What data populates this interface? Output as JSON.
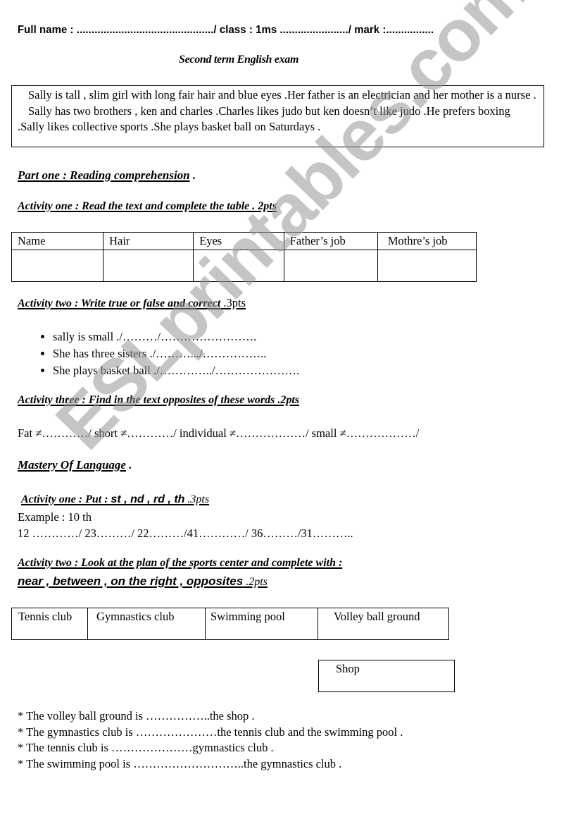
{
  "header": {
    "full_name_label": "Full name :",
    "full_name_blank": "............................................../",
    "class_label": " class : 1ms",
    "class_blank": " ......................./",
    "mark_label": " mark :",
    "mark_blank": "................",
    "title": "Second term English exam"
  },
  "passage": {
    "paragraphs": [
      "Sally is tall , slim girl with long fair hair and blue eyes .Her father is an electrician and her mother is a nurse .",
      "Sally has two brothers , ken and charles .Charles likes judo but ken doesn’t like judo .He prefers boxing .Sally likes collective sports .She plays basket ball on Saturdays ."
    ]
  },
  "part_one": {
    "heading": "Part one : Reading comprehension",
    "heading_suffix": " .",
    "activity_one": {
      "heading": "Activity one : Read the text and complete the table . 2pts",
      "table_headers": [
        "Name",
        "Hair",
        "Eyes",
        "Father’s job",
        "Mothre’s job"
      ],
      "table_blank_row": [
        "",
        "",
        "",
        "",
        ""
      ]
    },
    "activity_two": {
      "heading": "Activity two : Write true or false and correct",
      "points": " .3pts",
      "items": [
        "sally is small ./………/…………………….",
        "She  has three sisters ./……….../……………..",
        "She plays basket ball ./…………../…………………."
      ]
    },
    "activity_three": {
      "heading": "Activity three : Find in the text opposites of these words .2pts",
      "line": "Fat ≠…………/ short ≠…………/ individual ≠………………/ small ≠………………/"
    }
  },
  "mastery": {
    "heading": "Mastery Of Language",
    "heading_suffix": " .",
    "activity_one": {
      "heading_prefix": "Activity one : Put : ",
      "heading_suffixes": "st , nd , rd , th",
      "points": " .3pts",
      "example": "Example : 10 th",
      "line": " 12 …………/ 23………/ 22………/41…………/ 36………/31……….."
    },
    "activity_two": {
      "heading": "Activity two : Look at the plan of the sports center and complete with :",
      "words": "near , between , on the right , opposites",
      "points": " .2pts",
      "places": [
        "Tennis club",
        "Gymnastics club",
        "Swimming pool",
        "Volley ball ground"
      ],
      "shop": "Shop",
      "sentences": [
        "* The volley ball ground is ……………..the shop .",
        "* The gymnastics club is …………………the tennis club and the swimming pool .",
        "* The tennis club is  …………………gymnastics club .",
        "* The swimming pool is ………………………..the gymnastics club ."
      ]
    }
  },
  "watermark": "ESLprintables.com"
}
